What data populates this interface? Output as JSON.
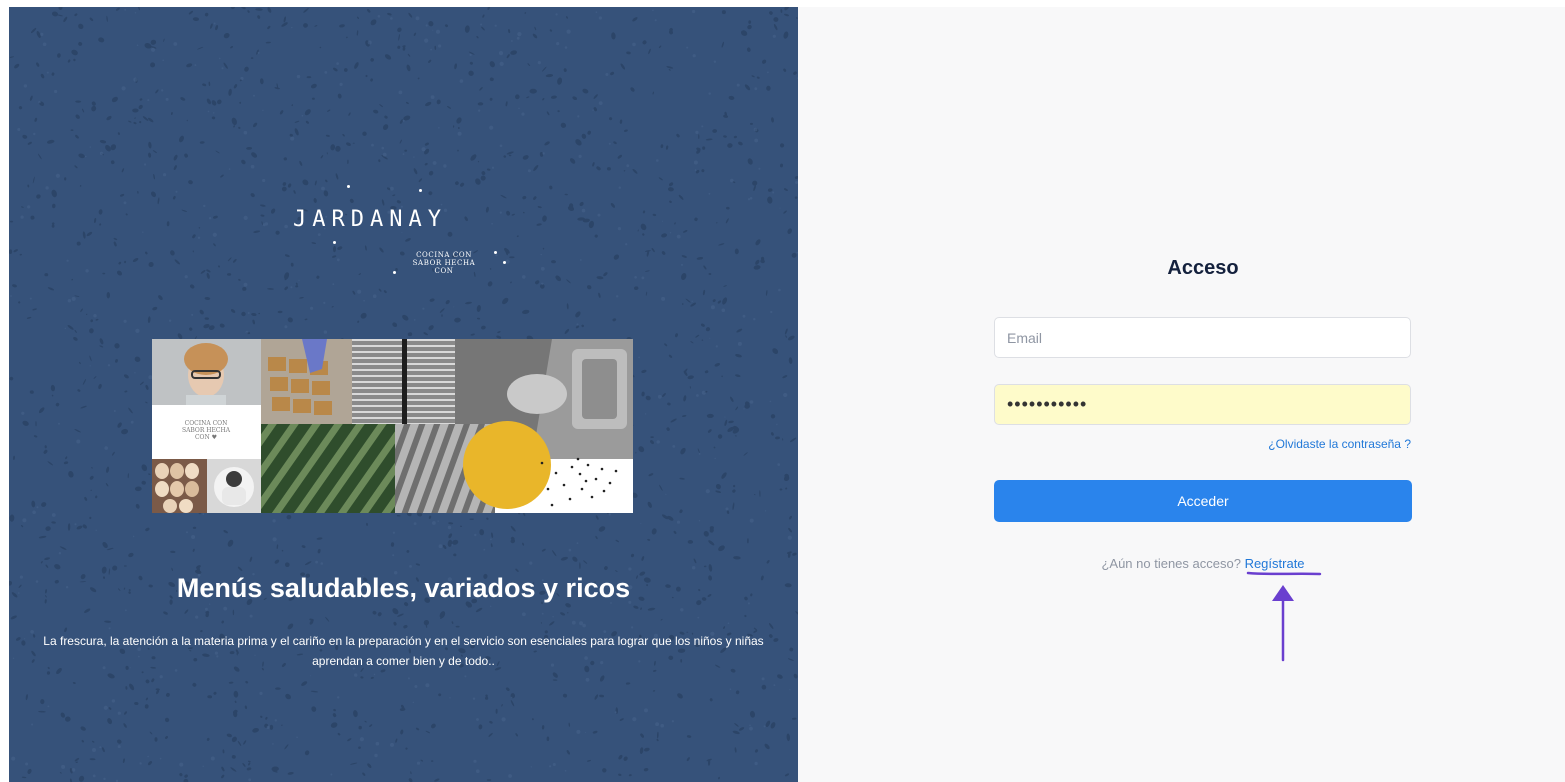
{
  "brand": {
    "name": "JARDANAY",
    "tagline_lines": [
      "COCINA CON",
      "SABOR HECHA",
      "CON"
    ]
  },
  "collage": {
    "card_lines": [
      "COCINA CON",
      "SABOR HECHA",
      "CON ♥"
    ]
  },
  "hero": {
    "title": "Menús saludables, variados y ricos",
    "description": "La frescura, la atención a la materia prima y el cariño en la preparación y en el servicio son esenciales para lograr que los niños y niñas aprendan a comer bien y de todo.."
  },
  "login": {
    "title": "Acceso",
    "email_placeholder": "Email",
    "email_value": "",
    "password_value": "•••••••••••",
    "forgot_label": "¿Olvidaste la contraseña ?",
    "submit_label": "Acceder",
    "register_prompt": "¿Aún no tienes acceso?",
    "register_link": "Regístrate"
  },
  "annotation": {
    "color": "#6a3fcf",
    "icon": "arrow-up-icon"
  },
  "colors": {
    "panel_blue": "#36527a",
    "accent_blue": "#2a84ec",
    "link_blue": "#2178d8",
    "autofill_yellow": "#fefbca"
  }
}
